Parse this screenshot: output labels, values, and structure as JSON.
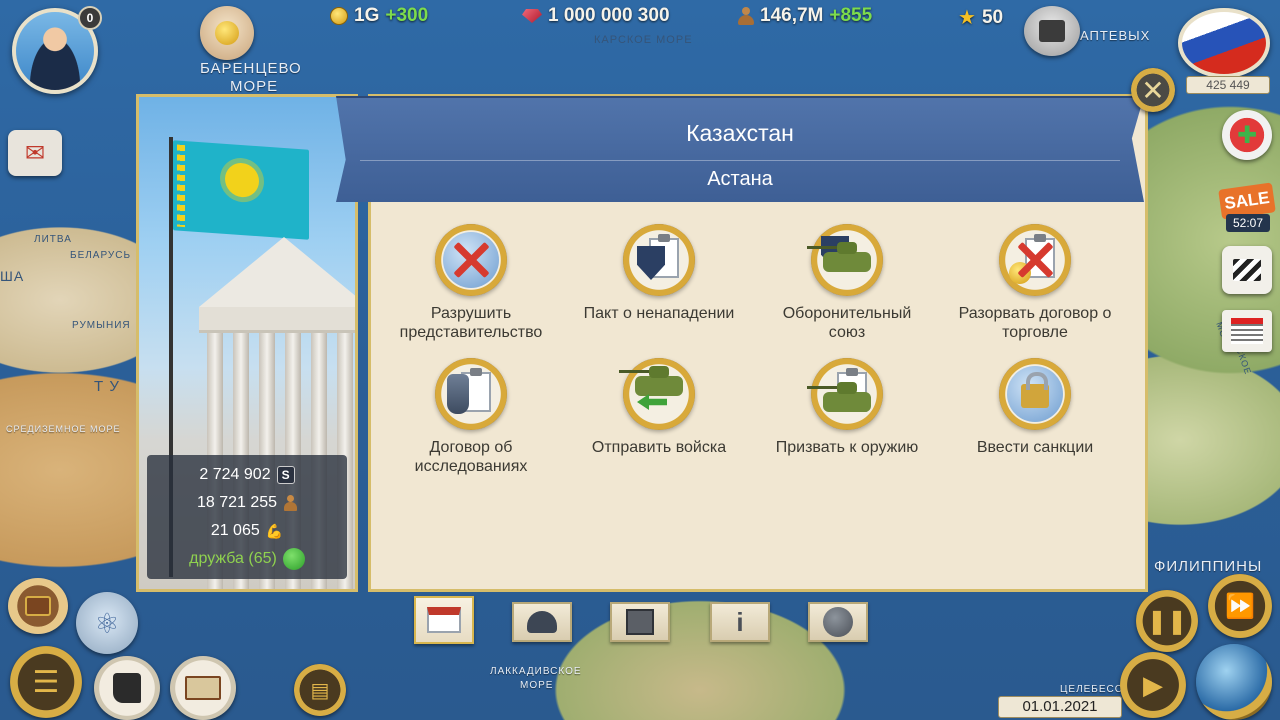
{
  "map": {
    "labels": {
      "barents_sea_line1": "БАРЕНЦЕВО",
      "barents_sea_line2": "МОРЕ",
      "kara_sea": "КАРСКОЕ МОРЕ",
      "laptev": "АПТЕВЫХ",
      "mediterranean": "СРЕДИЗЕМНОЕ МОРЕ",
      "philippines": "ФИЛИППИНЫ",
      "laccadive_line1": "ЛАККАДИВСКОЕ",
      "laccadive_line2": "МОРЕ",
      "celebes": "ЦЕЛЕБЕССК",
      "japan_sea": "ЯПОНСКОЕ МОРЕ",
      "lithuania": "ЛИТВА",
      "belarus": "БЕЛАРУСЬ",
      "usa": "ША",
      "romania": "РУМЫНИЯ",
      "tu": "Т У"
    }
  },
  "player": {
    "notification_count": "0",
    "rank_population": "425 449"
  },
  "resources": {
    "gold": "1G",
    "gold_delta": "+300",
    "gems": "1 000 000 300",
    "population": "146,7M",
    "population_delta": "+855",
    "stars": "50"
  },
  "dialog": {
    "country": "Казахстан",
    "capital": "Астана",
    "stats": {
      "gdp": "2 724 902",
      "gdp_icon_label": "S",
      "population": "18 721 255",
      "military": "21 065",
      "relation_label": "дружба (65)"
    },
    "actions": [
      {
        "label_line1": "Разрушить",
        "label_line2": "представительство",
        "icon": "embassy-destroy-icon"
      },
      {
        "label_line1": "Пакт о ненападении",
        "label_line2": "",
        "icon": "non-aggression-pact-icon"
      },
      {
        "label_line1": "Оборонительный",
        "label_line2": "союз",
        "icon": "defensive-alliance-icon"
      },
      {
        "label_line1": "Разорвать договор о",
        "label_line2": "торговле",
        "icon": "break-trade-icon"
      },
      {
        "label_line1": "Договор об",
        "label_line2": "исследованиях",
        "icon": "research-treaty-icon"
      },
      {
        "label_line1": "Отправить войска",
        "label_line2": "",
        "icon": "send-troops-icon"
      },
      {
        "label_line1": "Призвать к оружию",
        "label_line2": "",
        "icon": "call-to-arms-icon"
      },
      {
        "label_line1": "Ввести санкции",
        "label_line2": "",
        "icon": "sanctions-icon"
      }
    ]
  },
  "sidebar_right": {
    "sale_label": "SALE",
    "sale_timer": "52:07"
  },
  "footer": {
    "date": "01.01.2021"
  },
  "colors": {
    "ribbon": "#4a6ca3",
    "panel": "#f1e7d2",
    "gold_frame": "#d6bd6a",
    "positive": "#7ddc4c"
  }
}
